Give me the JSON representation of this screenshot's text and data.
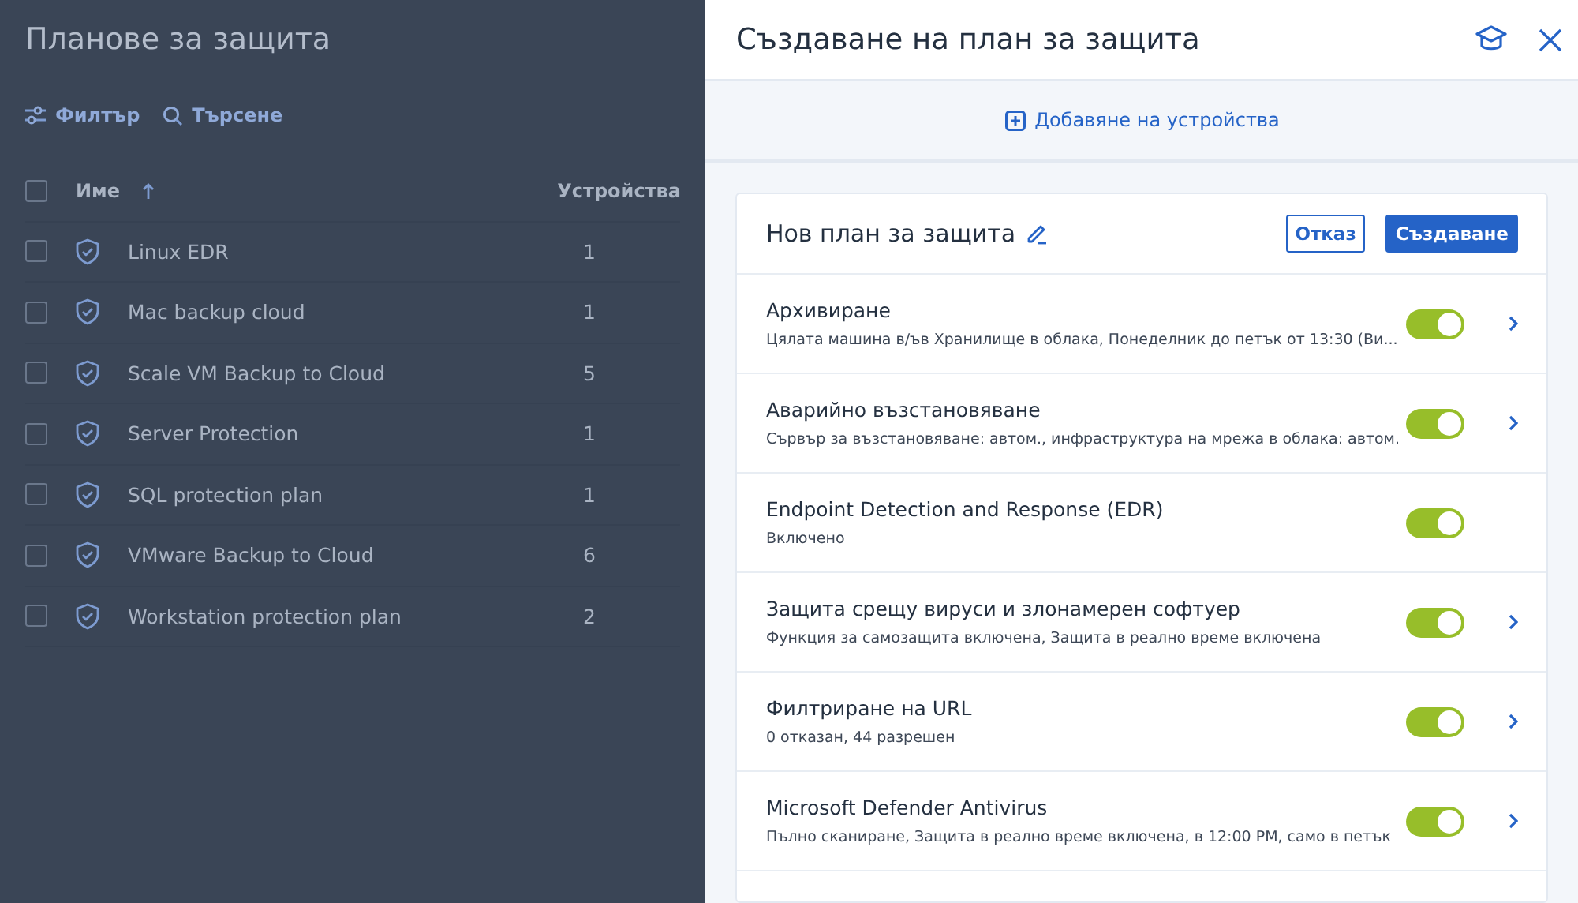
{
  "page": {
    "title": "Планове за защита",
    "toolbar": [
      {
        "kind": "filter",
        "label": "Филтър"
      },
      {
        "kind": "search",
        "label": "Търсене"
      }
    ],
    "table": {
      "columns": [
        "Име",
        "Устройства"
      ],
      "all_checked": false,
      "rows": [
        {
          "name": "Linux EDR",
          "devices": "1",
          "checked": false
        },
        {
          "name": "Mac backup cloud",
          "devices": "1",
          "checked": false
        },
        {
          "name": "Scale VM Backup to Cloud",
          "devices": "5",
          "checked": false
        },
        {
          "name": "Server Protection",
          "devices": "1",
          "checked": false
        },
        {
          "name": "SQL protection plan",
          "devices": "1",
          "checked": false
        },
        {
          "name": "VMware Backup to Cloud",
          "devices": "6",
          "checked": false
        },
        {
          "name": "Workstation protection plan",
          "devices": "2",
          "checked": false
        }
      ]
    }
  },
  "panel": {
    "title": "Създаване на план за защита",
    "add_devices": "Добавяне на устройства",
    "plan": {
      "name": "Нов план за защита",
      "cancel": "Отказ",
      "create": "Създаване",
      "modules": [
        {
          "title": "Архивиране",
          "summary": "Цялата машина в/ъв Хранилище в облака, Понеделник до петък от 13:30 (Ви...",
          "on": true,
          "expandable": true
        },
        {
          "title": "Аварийно възстановяване",
          "summary": "Сървър за възстановяване: автом., инфраструктура на мрежа в облака: автом.",
          "on": true,
          "expandable": true
        },
        {
          "title": "Endpoint Detection and Response (EDR)",
          "summary": "Включено",
          "on": true,
          "expandable": false
        },
        {
          "title": "Защита срещу вируси и злонамерен софтуер",
          "summary": "Функция за самозащита включена, Защита в реално време включена",
          "on": true,
          "expandable": true
        },
        {
          "title": "Филтриране на URL",
          "summary": "0 отказан, 44 разрешен",
          "on": true,
          "expandable": true
        },
        {
          "title": "Microsoft Defender Antivirus",
          "summary": "Пълно сканиране, Защита в реално време включена, в 12:00 PM, само в петък",
          "on": true,
          "expandable": true
        }
      ]
    }
  }
}
